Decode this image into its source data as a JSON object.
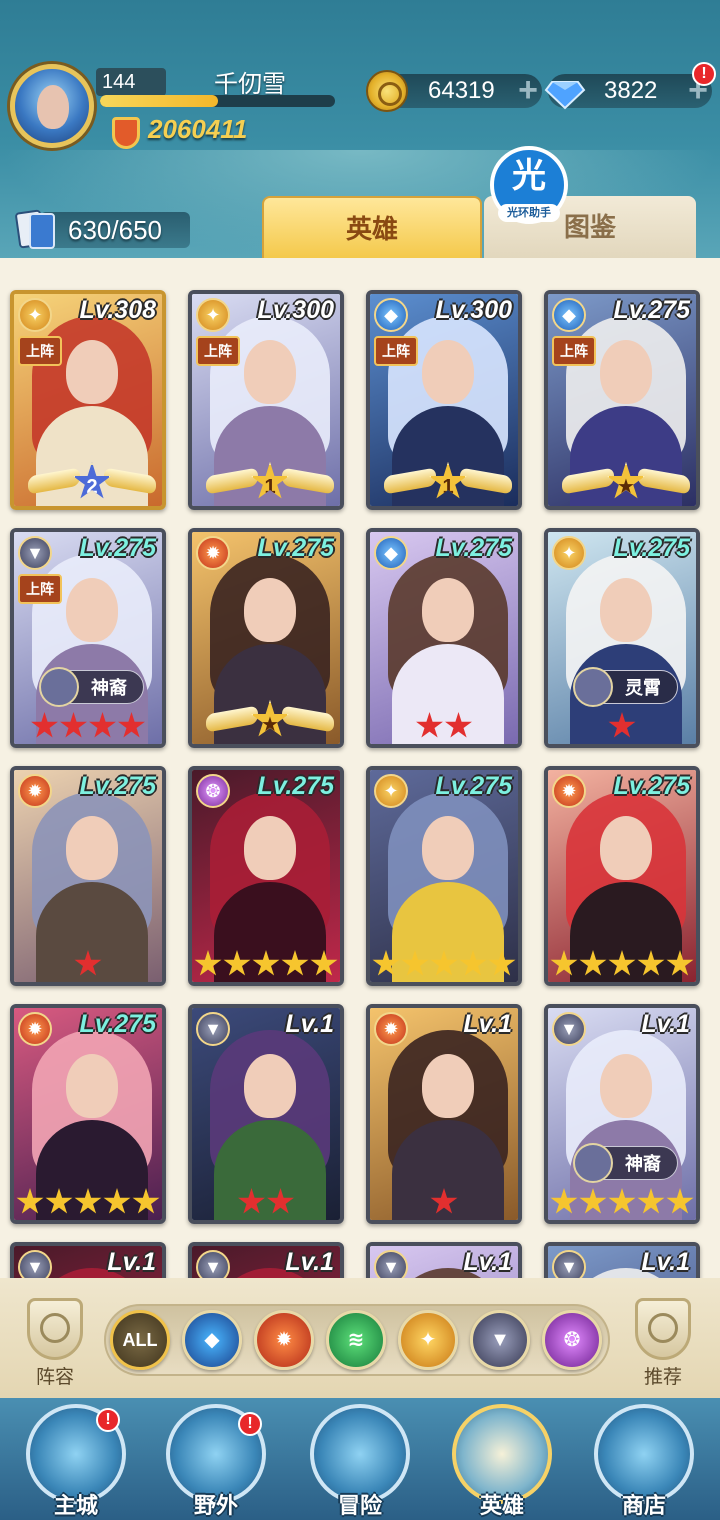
{
  "player": {
    "level": "144",
    "name": "千仞雪",
    "exp_fraction": 0.5,
    "power": "2060411"
  },
  "resources": {
    "gold": "64319",
    "gems": "3822",
    "gem_notice": "!"
  },
  "hero_count": "630/650",
  "tabs": {
    "heroes": "英雄",
    "codex": "图鉴"
  },
  "helper": {
    "glyph": "光",
    "label": "光环助手"
  },
  "cards": [
    {
      "level": "Lv.308",
      "faction": "light",
      "deployed": "上阵",
      "rank": "2",
      "rank_style": "blue",
      "theme": "gold"
    },
    {
      "level": "Lv.300",
      "faction": "light",
      "deployed": "上阵",
      "rank": "1",
      "rank_style": "gold",
      "theme": "silver"
    },
    {
      "level": "Lv.300",
      "faction": "water",
      "deployed": "上阵",
      "rank": "1",
      "rank_style": "gold",
      "theme": "blue"
    },
    {
      "level": "Lv.275",
      "faction": "water",
      "deployed": "上阵",
      "rank": "★",
      "rank_style": "gold",
      "theme": "purple"
    },
    {
      "level": "Lv.275",
      "faction": "dark",
      "deployed": "上阵",
      "tag": "神裔",
      "stars": 4,
      "star_color": "red",
      "theme": "silver"
    },
    {
      "level": "Lv.275",
      "faction": "fire",
      "rank": "★",
      "rank_style": "gold",
      "theme": "amber"
    },
    {
      "level": "Lv.275",
      "faction": "water",
      "stars": 2,
      "star_color": "red",
      "theme": "lavender"
    },
    {
      "level": "Lv.275",
      "faction": "light",
      "tag": "灵霄",
      "stars": 1,
      "star_color": "red",
      "theme": "ice"
    },
    {
      "level": "Lv.275",
      "faction": "fire",
      "stars": 1,
      "star_color": "red",
      "theme": "slate"
    },
    {
      "level": "Lv.275",
      "faction": "void",
      "stars": 5,
      "star_color": "gold",
      "theme": "crimson"
    },
    {
      "level": "Lv.275",
      "faction": "light",
      "stars": 5,
      "star_color": "gold",
      "theme": "storm"
    },
    {
      "level": "Lv.275",
      "faction": "fire",
      "stars": 5,
      "star_color": "gold",
      "theme": "rose"
    },
    {
      "level": "Lv.275",
      "faction": "fire",
      "stars": 5,
      "star_color": "gold",
      "theme": "witch"
    },
    {
      "level": "Lv.1",
      "faction": "dark",
      "stars": 2,
      "star_color": "red",
      "theme": "plague"
    },
    {
      "level": "Lv.1",
      "faction": "fire",
      "stars": 1,
      "star_color": "red",
      "theme": "amber"
    },
    {
      "level": "Lv.1",
      "faction": "dark",
      "tag": "神裔",
      "stars": 5,
      "star_color": "gold",
      "theme": "silver"
    },
    {
      "level": "Lv.1",
      "faction": "dark",
      "theme": "crimson"
    },
    {
      "level": "Lv.1",
      "faction": "dark",
      "theme": "crimson"
    },
    {
      "level": "Lv.1",
      "faction": "dark",
      "theme": "lavender"
    },
    {
      "level": "Lv.1",
      "faction": "dark",
      "theme": "purple"
    }
  ],
  "filters": {
    "all": "ALL",
    "lineup": "阵容",
    "recommend": "推荐"
  },
  "nav": {
    "city": "主城",
    "wild": "野外",
    "adventure": "冒险",
    "heroes": "英雄",
    "shop": "商店",
    "notice": "!"
  },
  "colors": {
    "header": "#3b8ea5",
    "gold_text": "#f5cf52",
    "alert_red": "#e8272a"
  }
}
